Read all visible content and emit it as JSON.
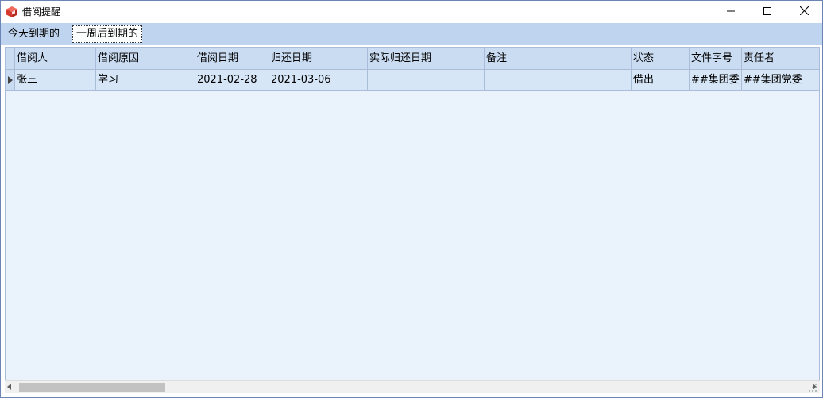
{
  "window": {
    "title": "借阅提醒",
    "icon": "red-cube-icon",
    "controls": [
      "minimize-icon",
      "maximize-icon",
      "close-icon"
    ]
  },
  "tabs": [
    {
      "label": "今天到期的",
      "selected": false
    },
    {
      "label": "一周后到期的",
      "selected": true
    }
  ],
  "table": {
    "columns": [
      "借阅人",
      "借阅原因",
      "借阅日期",
      "归还日期",
      "实际归还日期",
      "备注",
      "状态",
      "文件字号",
      "责任者"
    ],
    "rows": [
      [
        "张三",
        "学习",
        "2021-02-28",
        "2021-03-06",
        "",
        "",
        "借出",
        "##集团委",
        "##集团党委"
      ]
    ]
  },
  "colors": {
    "tabstrip_bg": "#bfd4ee",
    "header_bg": "#cadcf2",
    "row_bg": "#d6e6f7",
    "grid_bg": "#eaf2fb",
    "border": "#a9bcd8"
  }
}
